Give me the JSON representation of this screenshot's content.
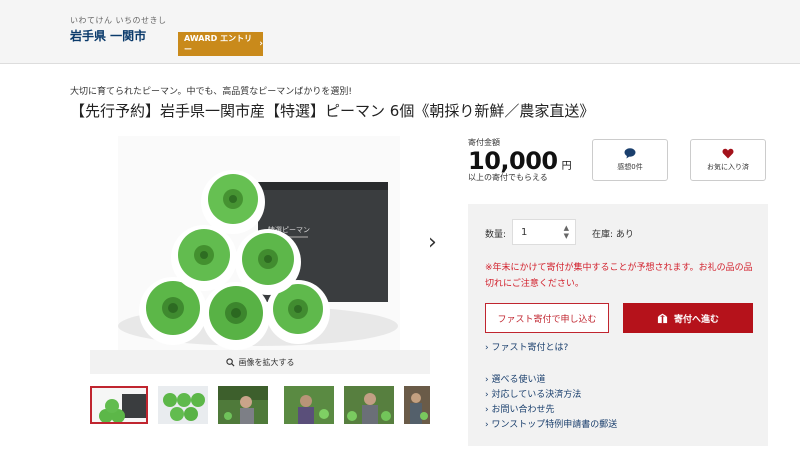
{
  "header": {
    "municipality_kana": "いわてけん いちのせきし",
    "municipality_name": "岩手県 一関市",
    "award_label": "AWARD エントリー",
    "award_chevron": "›"
  },
  "product": {
    "catchphrase": "大切に育てられたピーマン。中でも、高品質なピーマンばかりを選別!",
    "title": "【先行予約】岩手県一関市産【特選】ピーマン 6個《朝採り新鮮／農家直送》",
    "box_label": "特選ピーマン"
  },
  "gallery": {
    "zoom_label": "画像を拡大する",
    "next_arrow": "›",
    "thumb_count": 6,
    "selected_index": 0
  },
  "price": {
    "label": "寄付金額",
    "amount": "10,000",
    "unit": "円",
    "sub": "以上の寄付でもらえる"
  },
  "actions": {
    "reviews_label": "感想0件",
    "favorite_label": "お気に入り済"
  },
  "order": {
    "quantity_label": "数量:",
    "quantity_value": "1",
    "stock_label": "在庫: あり",
    "notice": "※年末にかけて寄付が集中することが予想されます。お礼の品の品切れにご注意ください。",
    "fast_button": "ファスト寄付で申し込む",
    "donate_button": "寄付へ進む",
    "fast_link": "› ファスト寄付とは?"
  },
  "links": [
    "› 選べる使い道",
    "› 対応している決済方法",
    "› お問い合わせ先",
    "› ワンストップ特例申請書の郵送"
  ],
  "colors": {
    "primary_red": "#b5121b",
    "award_gold": "#c98a1b",
    "link_navy": "#1a3f6d",
    "notice_red": "#d2202c"
  }
}
